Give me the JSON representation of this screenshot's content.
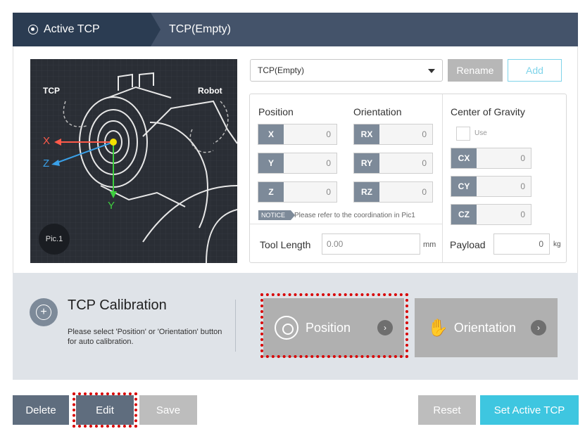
{
  "header": {
    "active_tab": "Active TCP",
    "tcp_name": "TCP(Empty)"
  },
  "picture": {
    "tcp_label": "TCP",
    "robot_label": "Robot",
    "axis_x": "X",
    "axis_y": "Y",
    "axis_z": "Z",
    "badge": "Pic.1"
  },
  "selector": {
    "value": "TCP(Empty)",
    "rename_label": "Rename",
    "add_label": "Add"
  },
  "position": {
    "title": "Position",
    "fields": [
      {
        "label": "X",
        "value": "0"
      },
      {
        "label": "Y",
        "value": "0"
      },
      {
        "label": "Z",
        "value": "0"
      }
    ]
  },
  "orientation": {
    "title": "Orientation",
    "fields": [
      {
        "label": "RX",
        "value": "0"
      },
      {
        "label": "RY",
        "value": "0"
      },
      {
        "label": "RZ",
        "value": "0"
      }
    ]
  },
  "cog": {
    "title": "Center of Gravity",
    "use_label": "Use",
    "fields": [
      {
        "label": "CX",
        "value": "0"
      },
      {
        "label": "CY",
        "value": "0"
      },
      {
        "label": "CZ",
        "value": "0"
      }
    ]
  },
  "notice": {
    "badge": "NOTICE",
    "text": "Please refer to the coordination in Pic1"
  },
  "tool": {
    "label": "Tool Length",
    "value": "0.00",
    "unit": "mm"
  },
  "payload": {
    "label": "Payload",
    "value": "0",
    "unit": "kg"
  },
  "calibration": {
    "title": "TCP Calibration",
    "description": "Please select 'Position' or 'Orientation' button for auto calibration.",
    "position_label": "Position",
    "orientation_label": "Orientation"
  },
  "footer": {
    "delete_label": "Delete",
    "edit_label": "Edit",
    "save_label": "Save",
    "reset_label": "Reset",
    "set_active_label": "Set Active TCP"
  },
  "colors": {
    "header_bg": "#44536a",
    "active_tab_bg": "#2b3c52",
    "accent": "#3ec6e0",
    "highlight": "#d80000"
  }
}
